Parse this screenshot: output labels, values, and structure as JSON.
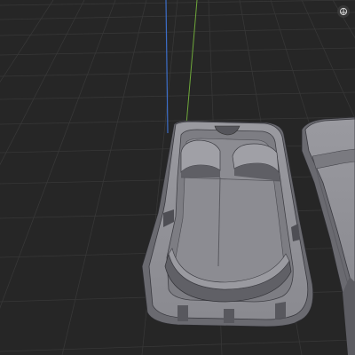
{
  "viewport": {
    "background": "#262626",
    "grid_color": "#373737",
    "axis_y_color": "#6ea83a",
    "axis_z_color": "#3c6ec8"
  },
  "objects": [
    {
      "name": "phone-case-main",
      "color": "#8e8e94"
    },
    {
      "name": "phone-case-second",
      "color": "#8e8e94"
    }
  ],
  "overlay": {
    "toggle_icon": "axis-gizmo-icon"
  }
}
